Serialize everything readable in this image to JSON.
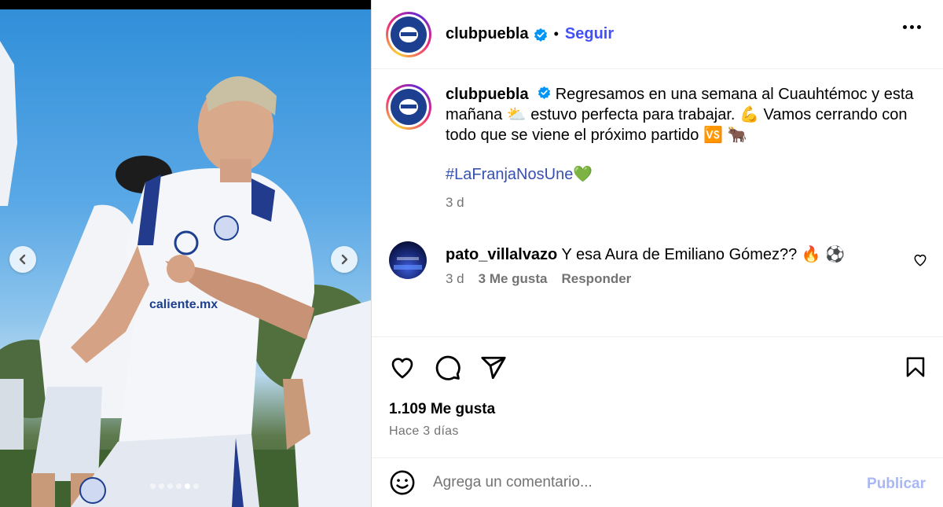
{
  "post": {
    "username": "clubpuebla",
    "follow_label": "Seguir",
    "separator": "•",
    "caption": {
      "username": "clubpuebla",
      "text": "Regresamos en una semana al Cuauhtémoc y esta mañana ⛅ estuvo perfecta para trabajar. 💪 Vamos cerrando con todo que se viene el próximo partido 🆚 🐂",
      "hashtag": "#LaFranjaNosUne💚",
      "time": "3 d"
    },
    "comments": [
      {
        "username": "pato_villalvazo",
        "text": "Y esa Aura de Emiliano Gómez?? 🔥 ⚽",
        "time": "3 d",
        "likes": "3 Me gusta",
        "reply_label": "Responder"
      }
    ],
    "likes_label": "1.109 Me gusta",
    "posted_ago": "Hace 3 días",
    "add_comment": {
      "placeholder": "Agrega un comentario...",
      "publish_label": "Publicar"
    },
    "carousel": {
      "total_images": 6,
      "active_index": 4
    }
  },
  "icons": {
    "verified": "verified-badge-icon",
    "more": "more-options-icon",
    "like": "heart-icon",
    "comment": "comment-icon",
    "share": "share-icon",
    "save": "bookmark-icon",
    "emoji": "smiley-icon",
    "prev": "chevron-left-icon",
    "next": "chevron-right-icon"
  },
  "colors": {
    "follow": "#4150f7",
    "hashtag": "#3850b0",
    "verified": "#0095f6",
    "publish_disabled": "#a9b7f3",
    "club_blue": "#1d3f8f"
  }
}
